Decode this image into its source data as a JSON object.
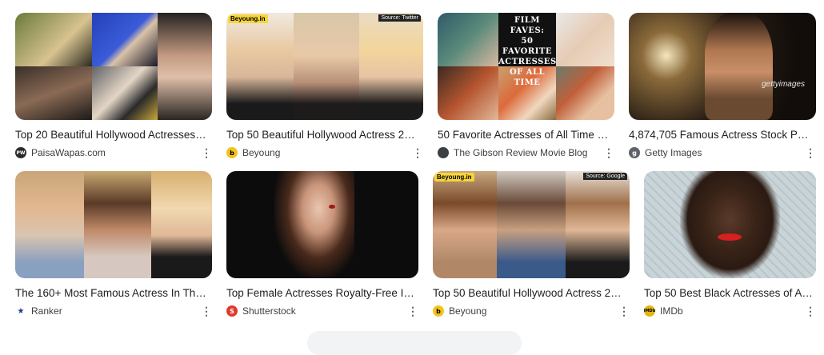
{
  "results": [
    {
      "title": "Top 20 Beautiful Hollywood Actresses wi...",
      "source": "PaisaWapas.com",
      "favicon": "PW",
      "favicon_color": "#2b2b2b"
    },
    {
      "title": "Top 50 Beautiful Hollywood Actress 202...",
      "source": "Beyoung",
      "favicon": "b",
      "favicon_color": "#f2c31b",
      "badge": "Beyoung.in",
      "badge2": "Source: Twitter"
    },
    {
      "title": "50 Favorite Actresses of All Time — ...",
      "source": "The Gibson Review Movie Blog",
      "favicon": "",
      "favicon_color": "#3c4043",
      "overlay": "FILM FAVES:\n50 FAVORITE\nACTRESSES\nOF ALL TIME"
    },
    {
      "title": "4,874,705 Famous Actress Stock Phot...",
      "source": "Getty Images",
      "favicon": "g",
      "favicon_color": "#5f6368",
      "watermark": "gettyimages"
    },
    {
      "title": "The 160+ Most Famous Actress In The W...",
      "source": "Ranker",
      "favicon": "★",
      "favicon_color": "#1a3b8e"
    },
    {
      "title": "Top Female Actresses Royalty-Free Ima...",
      "source": "Shutterstock",
      "favicon": "S",
      "favicon_color": "#e03a2f"
    },
    {
      "title": "Top 50 Beautiful Hollywood Actress 202...",
      "source": "Beyoung",
      "favicon": "b",
      "favicon_color": "#f2c31b",
      "badge": "Beyoung.in",
      "badge2": "Source: Google"
    },
    {
      "title": "Top 50 Best Black Actresses of All T...",
      "source": "IMDb",
      "favicon": "IMDb",
      "favicon_color": "#e2b616"
    }
  ],
  "more_icon": "more-vertical-icon"
}
